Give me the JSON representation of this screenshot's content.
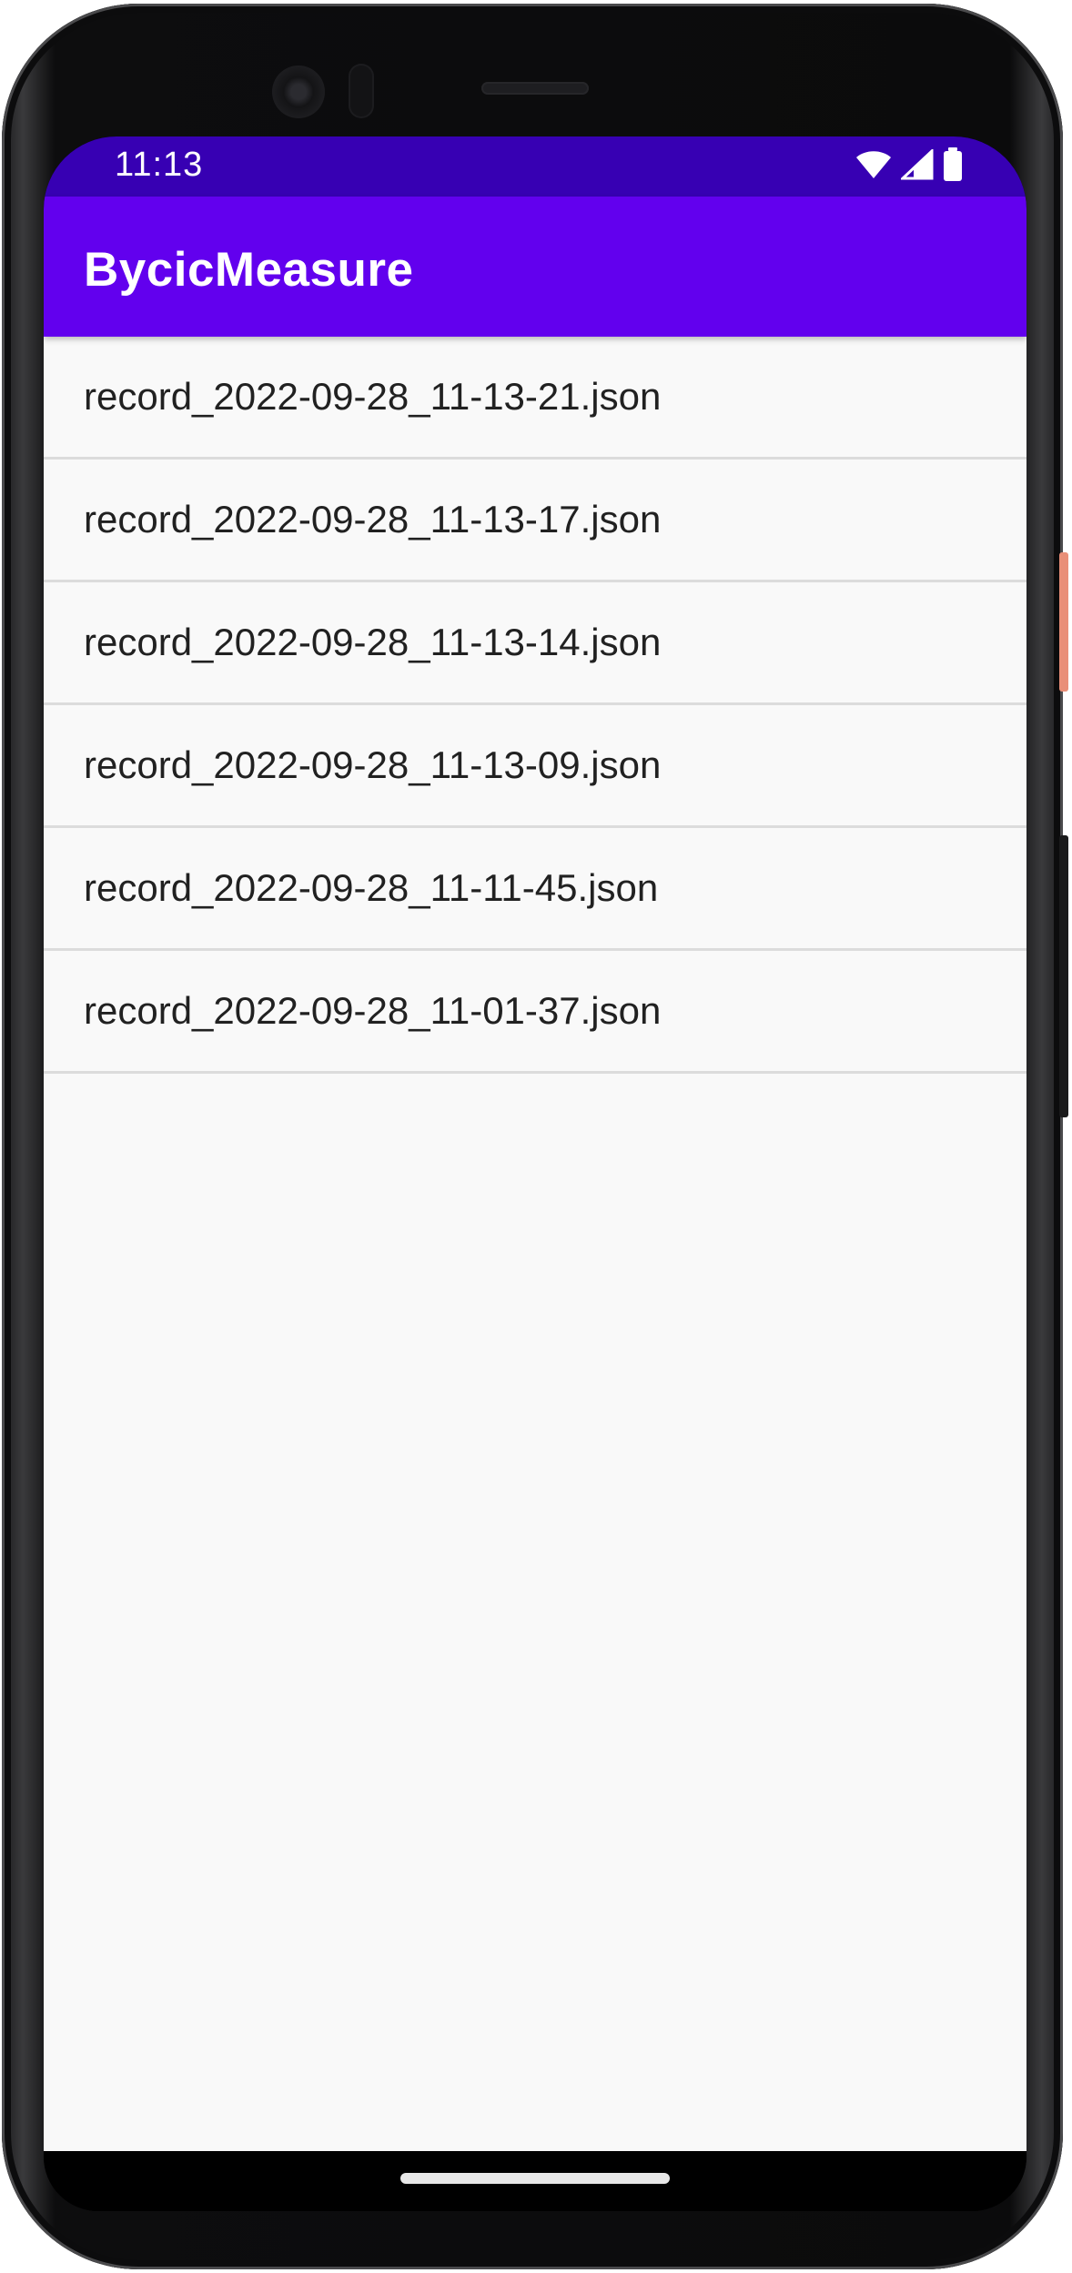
{
  "status_bar": {
    "time": "11:13",
    "icons": [
      "wifi-icon",
      "cell-signal-icon",
      "battery-icon"
    ]
  },
  "app_bar": {
    "title": "BycicMeasure",
    "color": "#6200ee",
    "status_color": "#3700b3"
  },
  "files": [
    {
      "name": "record_2022-09-28_11-13-21.json"
    },
    {
      "name": "record_2022-09-28_11-13-17.json"
    },
    {
      "name": "record_2022-09-28_11-13-14.json"
    },
    {
      "name": "record_2022-09-28_11-13-09.json"
    },
    {
      "name": "record_2022-09-28_11-11-45.json"
    },
    {
      "name": "record_2022-09-28_11-01-37.json"
    }
  ]
}
